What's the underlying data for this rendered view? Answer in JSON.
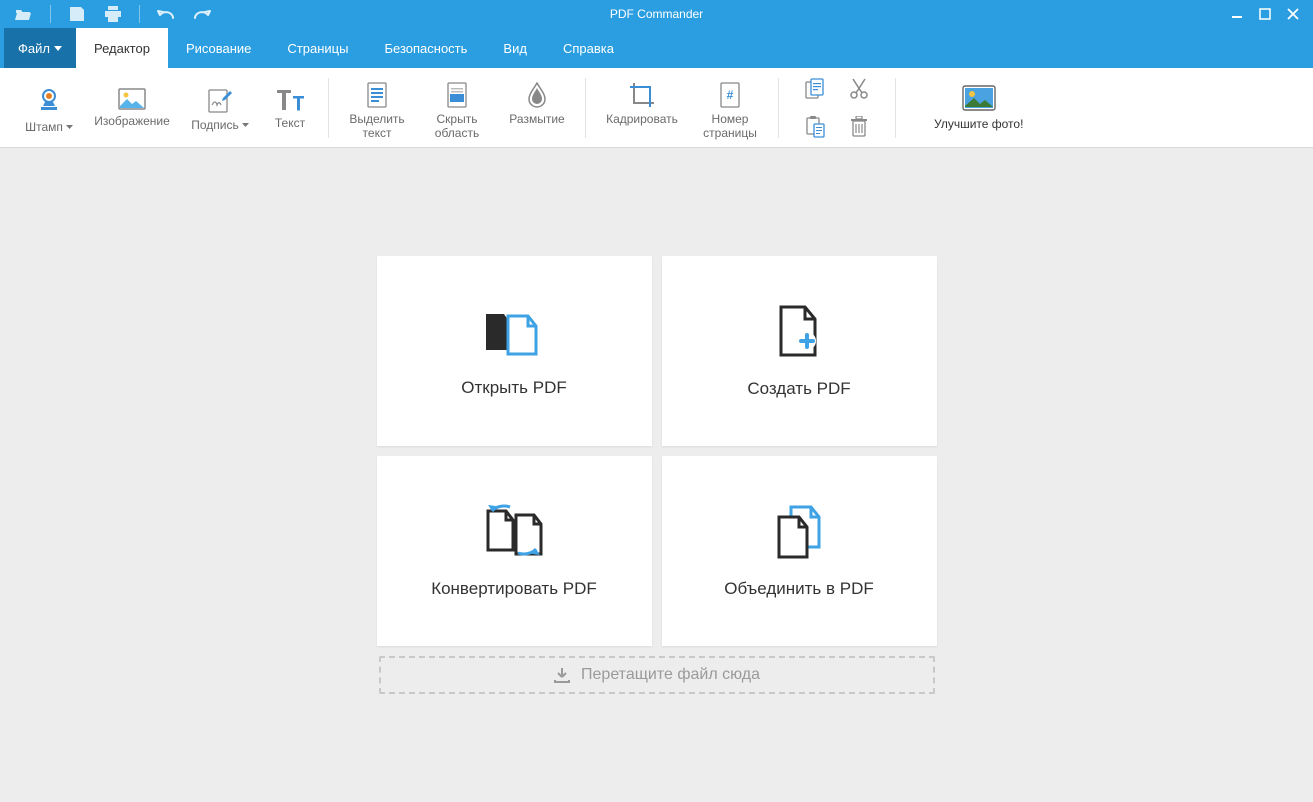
{
  "app": {
    "title": "PDF Commander"
  },
  "qat": {
    "open_icon": "folder-open-icon",
    "save_icon": "save-icon",
    "print_icon": "print-icon",
    "undo_icon": "undo-icon",
    "redo_icon": "redo-icon"
  },
  "window_controls": {
    "minimize": "–",
    "maximize": "◻",
    "close": "✕"
  },
  "menu": {
    "file_label": "Файл",
    "tabs": [
      {
        "label": "Редактор",
        "active": true
      },
      {
        "label": "Рисование",
        "active": false
      },
      {
        "label": "Страницы",
        "active": false
      },
      {
        "label": "Безопасность",
        "active": false
      },
      {
        "label": "Вид",
        "active": false
      },
      {
        "label": "Справка",
        "active": false
      }
    ]
  },
  "ribbon": {
    "stamp": "Штамп",
    "image": "Изображение",
    "signature": "Подпись",
    "text": "Текст",
    "highlight": "Выделить текст",
    "hide_area": "Скрыть область",
    "blur": "Размытие",
    "crop": "Кадрировать",
    "page_number": "Номер страницы",
    "copy_icon": "copy-icon",
    "cut_icon": "cut-icon",
    "paste_icon": "paste-icon",
    "delete_icon": "trash-icon",
    "promo": "Улучшите фото!"
  },
  "start": {
    "open": "Открыть PDF",
    "create": "Создать PDF",
    "convert": "Конвертировать PDF",
    "merge": "Объединить в PDF",
    "drop": "Перетащите файл сюда"
  }
}
